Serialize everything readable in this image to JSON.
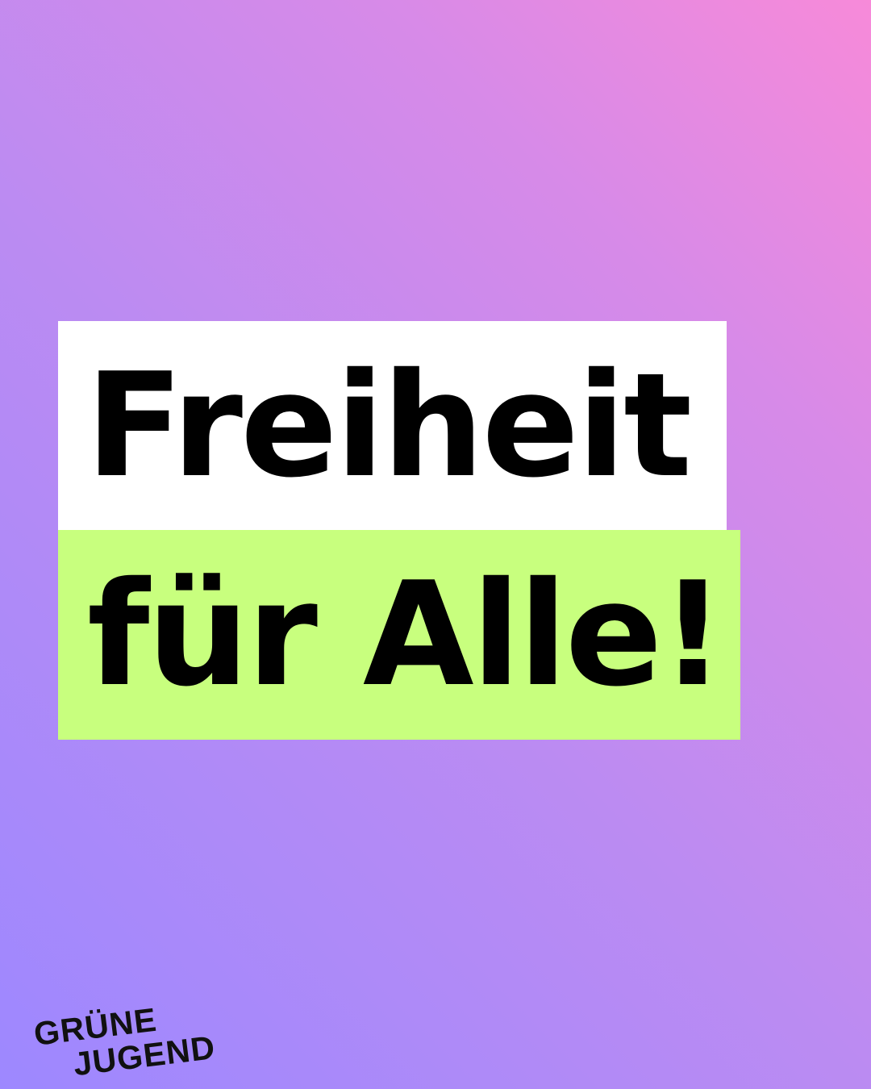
{
  "headline": {
    "line1": "Freiheit",
    "line2": "für Alle!"
  },
  "logo": {
    "line1": "GRÜNE",
    "line2": "JUGEND"
  },
  "colors": {
    "gradient_bottom_left": "#9d88ff",
    "gradient_top_right": "#f78ad9",
    "line1_highlight": "#ffffff",
    "line2_highlight": "#c8ff7e",
    "text": "#000000"
  }
}
